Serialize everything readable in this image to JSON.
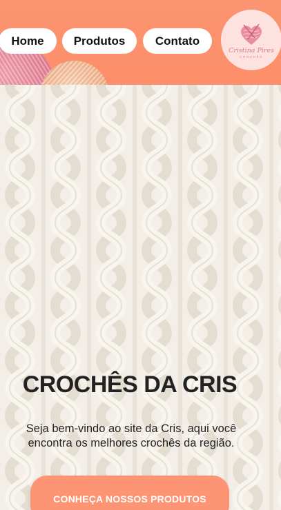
{
  "header": {
    "nav": [
      {
        "label": "Home"
      },
      {
        "label": "Produtos"
      },
      {
        "label": "Contato"
      }
    ],
    "logo": {
      "name": "Cristina Pires",
      "tagline": "CROCHÊS",
      "icon": "yarn-heart-icon"
    }
  },
  "hero": {
    "title": "CROCHÊS DA CRIS",
    "text": "Seja bem-vindo ao site da Cris, aqui você encontra os melhores crochês da região.",
    "cta_label": "CONHEÇA NOSSOS PRODUTOS"
  },
  "colors": {
    "header_bg": "#fd8e6a",
    "cta_bg": "#fd9474",
    "logo_bg": "#fde2df",
    "logo_accent": "#d97a92"
  }
}
